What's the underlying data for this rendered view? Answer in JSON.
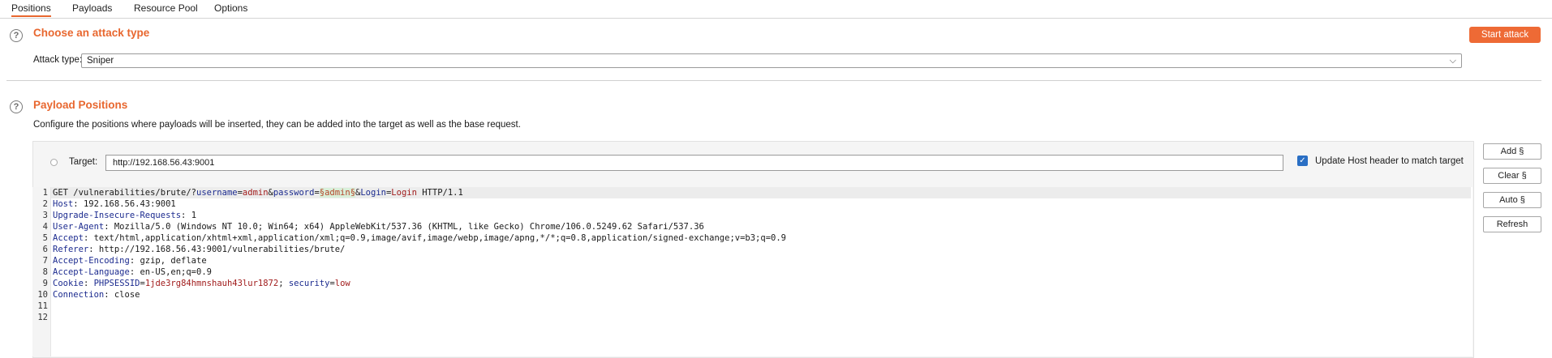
{
  "tabs": [
    "Positions",
    "Payloads",
    "Resource Pool",
    "Options"
  ],
  "attack_section": {
    "title": "Choose an attack type",
    "start_button": "Start attack",
    "type_label": "Attack type:",
    "type_value": "Sniper"
  },
  "payload_section": {
    "title": "Payload Positions",
    "description": "Configure the positions where payloads will be inserted, they can be added into the target as well as the base request."
  },
  "target": {
    "label": "Target:",
    "value": "http://192.168.56.43:9001",
    "update_host_label": "Update Host header to match target",
    "update_host_checked": true
  },
  "side_buttons": [
    "Add §",
    "Clear §",
    "Auto §",
    "Refresh"
  ],
  "request": {
    "line_numbers": [
      "1",
      "2",
      "3",
      "4",
      "5",
      "6",
      "7",
      "8",
      "9",
      "10",
      "11",
      "12"
    ],
    "line1": {
      "method_path": "GET /vulnerabilities/brute/?",
      "p1_key": "username",
      "eq1": "=",
      "p1_val": "admin",
      "amp1": "&",
      "p2_key": "password",
      "eq2": "=",
      "p2_val": "§admin§",
      "amp2": "&",
      "p3_key": "Login",
      "eq3": "=",
      "p3_val": "Login",
      "tail": " HTTP/1.1"
    },
    "headers": [
      {
        "name": "Host",
        "value": ": 192.168.56.43:9001"
      },
      {
        "name": "Upgrade-Insecure-Requests",
        "value": ": 1"
      },
      {
        "name": "User-Agent",
        "value": ": Mozilla/5.0 (Windows NT 10.0; Win64; x64) AppleWebKit/537.36 (KHTML, like Gecko) Chrome/106.0.5249.62 Safari/537.36"
      },
      {
        "name": "Accept",
        "value": ": text/html,application/xhtml+xml,application/xml;q=0.9,image/avif,image/webp,image/apng,*/*;q=0.8,application/signed-exchange;v=b3;q=0.9"
      },
      {
        "name": "Referer",
        "value": ": http://192.168.56.43:9001/vulnerabilities/brute/"
      },
      {
        "name": "Accept-Encoding",
        "value": ": gzip, deflate"
      },
      {
        "name": "Accept-Language",
        "value": ": en-US,en;q=0.9"
      }
    ],
    "cookie": {
      "name": "Cookie",
      "sep": ": ",
      "k1": "PHPSESSID",
      "eq1": "=",
      "v1": "1jde3rg84hmnshauh43lur1872",
      "semi": "; ",
      "k2": "security",
      "eq2": "=",
      "v2": "low"
    },
    "connection": {
      "name": "Connection",
      "value": ": close"
    }
  },
  "colors": {
    "accent": "#e8672f",
    "start_button": "#ee6a35",
    "checkbox": "#2a6fc4",
    "param_key": "#1c2b8f",
    "param_value": "#a11c1c",
    "payload_marker_bg": "#d9efd9"
  }
}
